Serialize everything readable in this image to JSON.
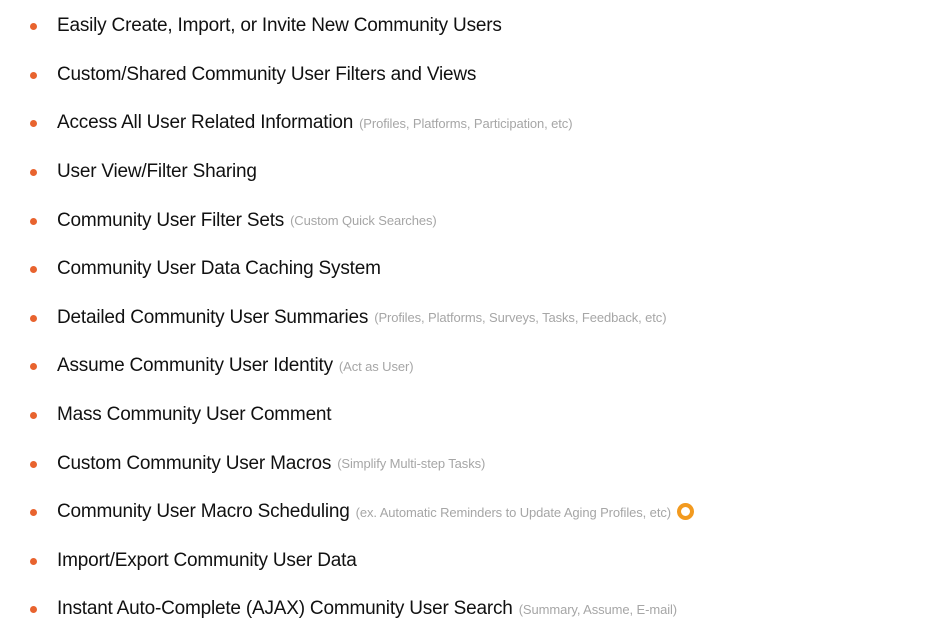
{
  "bullet_color": "#e8632e",
  "marker_color": "#f29a1f",
  "features": [
    {
      "label": "Easily Create, Import, or Invite New Community Users",
      "note": ""
    },
    {
      "label": "Custom/Shared Community User Filters and Views",
      "note": ""
    },
    {
      "label": "Access All User Related Information",
      "note": "(Profiles, Platforms, Participation, etc)"
    },
    {
      "label": "User View/Filter Sharing",
      "note": ""
    },
    {
      "label": "Community User Filter Sets",
      "note": "(Custom Quick Searches)"
    },
    {
      "label": "Community User Data Caching System",
      "note": ""
    },
    {
      "label": "Detailed Community User Summaries",
      "note": "(Profiles, Platforms, Surveys, Tasks, Feedback, etc)"
    },
    {
      "label": "Assume Community User Identity",
      "note": "(Act as User)"
    },
    {
      "label": "Mass Community User Comment",
      "note": ""
    },
    {
      "label": "Custom Community User Macros",
      "note": "(Simplify Multi-step Tasks)"
    },
    {
      "label": "Community User Macro Scheduling",
      "note": "(ex. Automatic Reminders to Update Aging Profiles, etc)",
      "marker_icon": "orange-ring-icon"
    },
    {
      "label": "Import/Export Community User Data",
      "note": ""
    },
    {
      "label": "Instant Auto-Complete (AJAX) Community User Search",
      "note": "(Summary, Assume, E-mail)"
    }
  ]
}
